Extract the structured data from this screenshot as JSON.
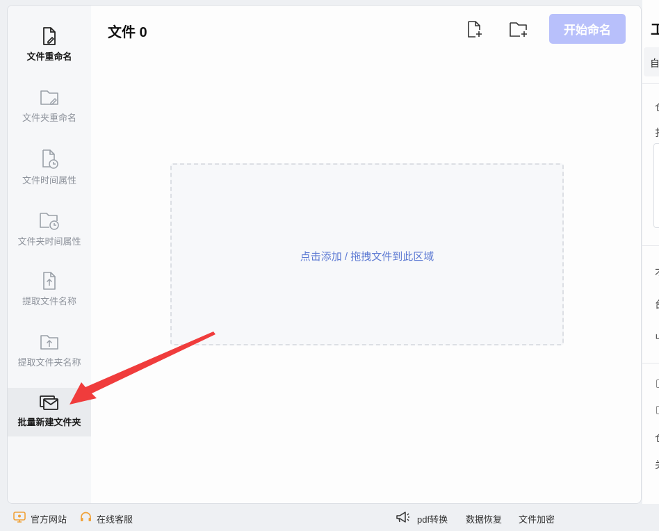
{
  "sidebar": {
    "items": [
      {
        "label": "文件重命名",
        "icon": "file-edit-icon",
        "active": true
      },
      {
        "label": "文件夹重命名",
        "icon": "folder-edit-icon"
      },
      {
        "label": "文件时间属性",
        "icon": "file-clock-icon"
      },
      {
        "label": "文件夹时间属性",
        "icon": "folder-clock-icon"
      },
      {
        "label": "提取文件名称",
        "icon": "file-upload-icon"
      },
      {
        "label": "提取文件夹名称",
        "icon": "folder-upload-icon"
      },
      {
        "label": "批量新建文件夹",
        "icon": "batch-folder-icon",
        "selected": true
      }
    ]
  },
  "main": {
    "title": "文件 0",
    "start_label": "开始命名",
    "dropzone_text": "点击添加 / 拖拽文件到此区域"
  },
  "right_panel": {
    "heading": "工",
    "box_text": "自",
    "frags": [
      "仓",
      "扌",
      "才",
      "台",
      "屮",
      "仓",
      "关"
    ]
  },
  "footer": {
    "website": "官方网站",
    "support": "在线客服",
    "pdf": "pdf转换",
    "recovery": "数据恢复",
    "encrypt": "文件加密"
  },
  "colors": {
    "accent": "#b8c0fb",
    "link": "#5d7ad3",
    "annotation": "#f03c3c"
  }
}
